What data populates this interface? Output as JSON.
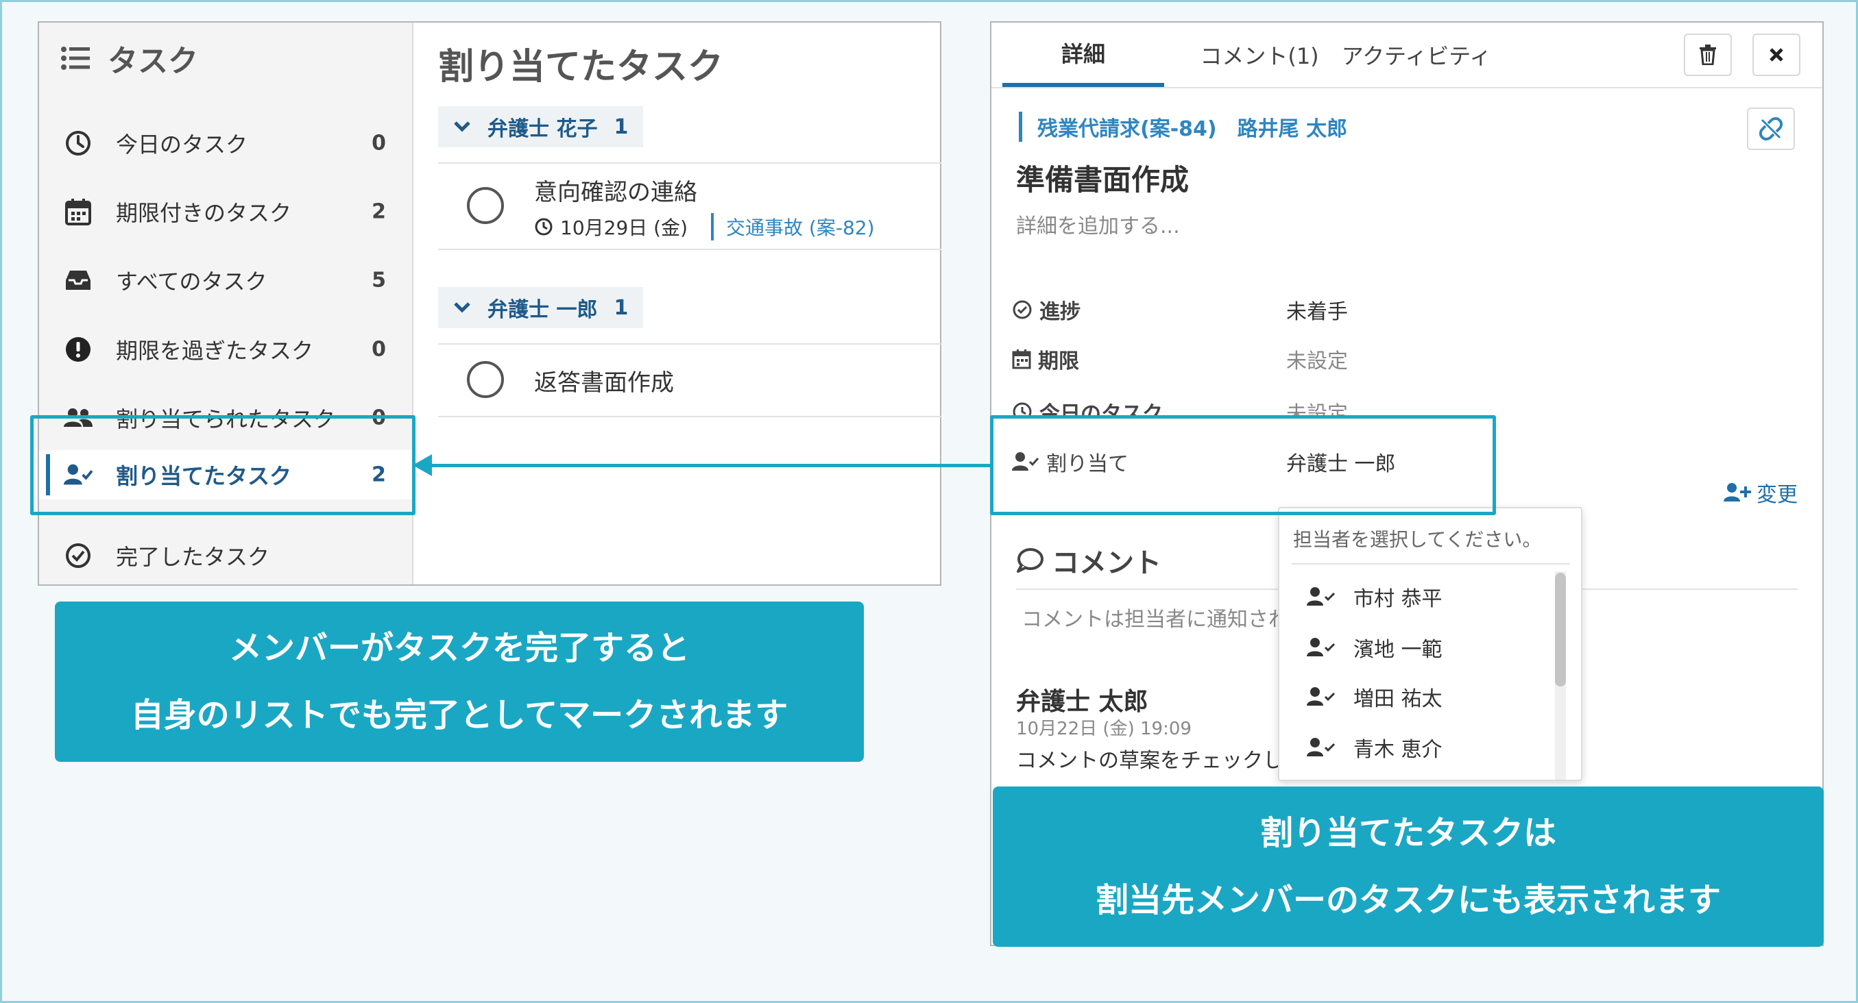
{
  "sidebar": {
    "title": "タスク",
    "items": [
      {
        "label": "今日のタスク",
        "count": "0",
        "icon": "clock-icon"
      },
      {
        "label": "期限付きのタスク",
        "count": "2",
        "icon": "calendar-icon"
      },
      {
        "label": "すべてのタスク",
        "count": "5",
        "icon": "inbox-icon"
      },
      {
        "label": "期限を過ぎたタスク",
        "count": "0",
        "icon": "alert-icon"
      },
      {
        "label": "割り当てられたタスク",
        "count": "0",
        "icon": "users-icon"
      },
      {
        "label": "割り当てたタスク",
        "count": "2",
        "icon": "user-check-icon"
      },
      {
        "label": "完了したタスク",
        "count": "",
        "icon": "check-circle-icon"
      }
    ]
  },
  "main": {
    "title": "割り当てたタスク",
    "groups": [
      {
        "name": "弁護士 花子",
        "count": "1",
        "tasks": [
          {
            "title": "意向確認の連絡",
            "date": "10月29日 (金)",
            "case": "交通事故 (案-82)"
          }
        ]
      },
      {
        "name": "弁護士 一郎",
        "count": "1",
        "tasks": [
          {
            "title": "返答書面作成"
          }
        ]
      }
    ]
  },
  "detail": {
    "tabs": [
      "詳細",
      "コメント(1)",
      "アクティビティ"
    ],
    "case_link": "残業代請求(案-84)",
    "case_owner": "路井尾 太郎",
    "title": "準備書面作成",
    "description_placeholder": "詳細を追加する...",
    "props": {
      "progress_label": "進捗",
      "progress_value": "未着手",
      "due_label": "期限",
      "due_value": "未設定",
      "today_label": "今日のタスク",
      "today_value": "未設定",
      "assign_label": "割り当て",
      "assign_value": "弁護士 一郎"
    },
    "change_label": "変更",
    "comments_title": "コメント",
    "comment_hint": "コメントは担当者に通知され",
    "comment": {
      "author": "弁護士 太郎",
      "time": "10月22日 (金) 19:09",
      "text": "コメントの草案をチェックし"
    }
  },
  "dropdown": {
    "hint": "担当者を選択してください。",
    "options": [
      "市村 恭平",
      "濱地 一範",
      "増田 祐太",
      "青木 恵介"
    ]
  },
  "callouts": {
    "left_line1": "メンバーがタスクを完了すると",
    "left_line2": "自身のリストでも完了としてマークされます",
    "right_line1": "割り当てたタスクは",
    "right_line2": "割当先メンバーのタスクにも表示されます"
  },
  "colors": {
    "accent": "#1aa7c4",
    "link": "#2e86c1",
    "active": "#1f5a8a"
  }
}
